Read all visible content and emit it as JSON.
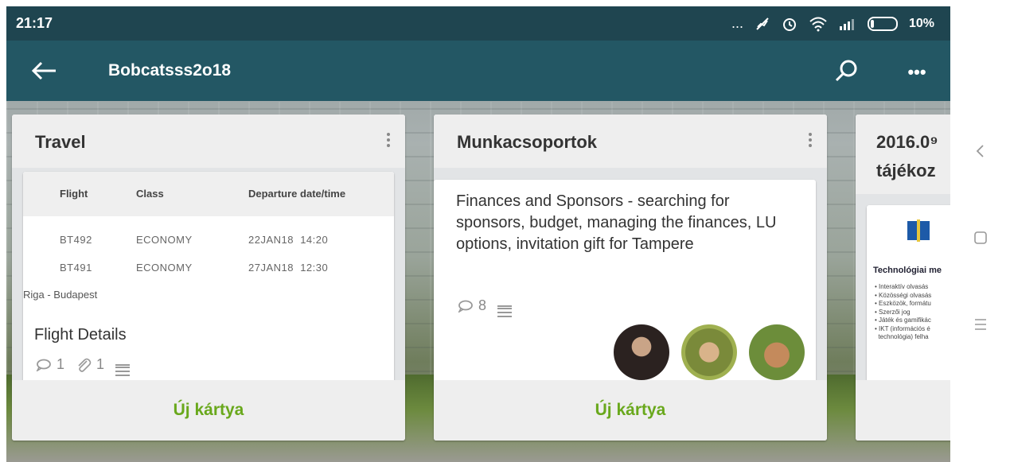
{
  "status_bar": {
    "time": "21:17",
    "dots": "...",
    "battery_text": "10%"
  },
  "app_bar": {
    "title": "Bobcatsss2o18"
  },
  "lists": [
    {
      "title": "Travel",
      "cards": [
        {
          "table": {
            "headers": [
              "Flight",
              "Class",
              "Departure date/time"
            ],
            "rows": [
              [
                "BT492",
                "ECONOMY",
                "22JAN18  14:20"
              ],
              [
                "BT491",
                "ECONOMY",
                "27JAN18  12:30"
              ]
            ],
            "route": "Riga - Budapest"
          },
          "title": "Flight Details",
          "comments": "1",
          "attachments": "1"
        }
      ],
      "footer": "Új kártya"
    },
    {
      "title": "Munkacsoportok",
      "cards": [
        {
          "title": "Finances and Sponsors - searching for sponsors, budget, managing the finances, LU options, invitation gift for Tampere",
          "comments": "8"
        }
      ],
      "footer": "Új kártya"
    },
    {
      "title": "2016.0⁹ tájékoz",
      "title_line1": "2016.0⁹",
      "title_line2": "tájékoz",
      "thumb": {
        "heading": "Technológiai me",
        "bullets": [
          "Interaktív olvasás",
          "Közösségi olvasás",
          "Eszközök, formátu",
          "Szerzői jog",
          "Játék és gamifikác",
          "IKT (információs é",
          "technológia) felha"
        ]
      }
    }
  ],
  "colors": {
    "status_bar": "#1f4550",
    "app_bar": "#235764",
    "accent_green": "#69a81c"
  }
}
